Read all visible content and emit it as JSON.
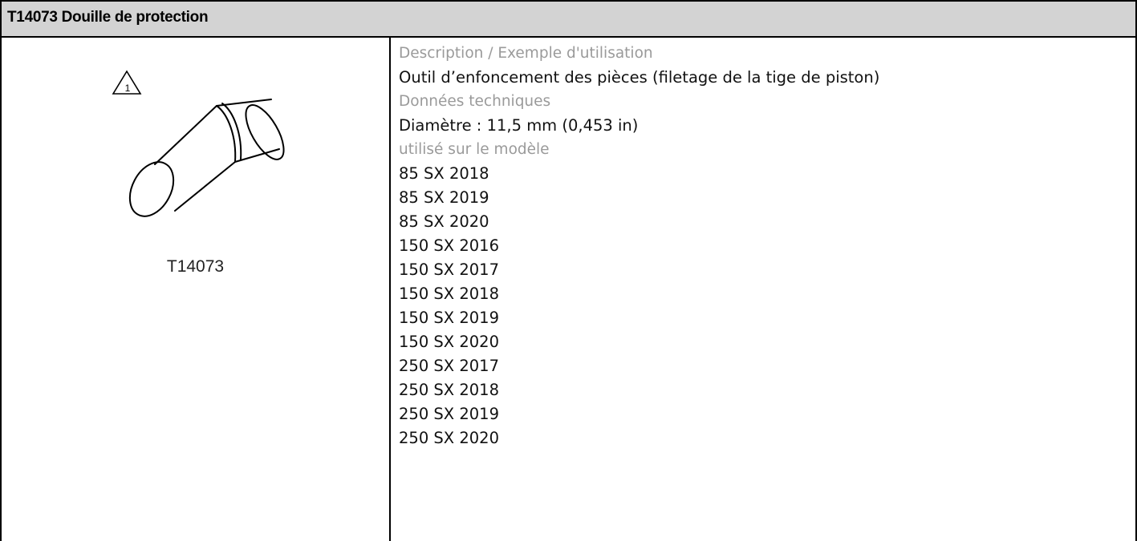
{
  "title": "T14073 Douille de protection",
  "tool": {
    "caption": "T14073",
    "warning_number": "1",
    "icon": "tool-cylinder-illustration"
  },
  "details": {
    "description_label": "Description / Exemple d'utilisation",
    "description_value": "Outil d’enfoncement des pièces (filetage de la tige de piston)",
    "tech_label": "Données techniques",
    "tech_value": "Diamètre : 11,5 mm (0,453 in)",
    "models_label": "utilisé sur le modèle",
    "models": [
      "85 SX 2018",
      "85 SX 2019",
      "85 SX 2020",
      "150 SX 2016",
      "150 SX 2017",
      "150 SX 2018",
      "150 SX 2019",
      "150 SX 2020",
      "250 SX 2017",
      "250 SX 2018",
      "250 SX 2019",
      "250 SX 2020"
    ]
  },
  "colors": {
    "header_bg": "#d3d3d3",
    "label_gray": "#9a9a9a",
    "border": "#000000"
  }
}
